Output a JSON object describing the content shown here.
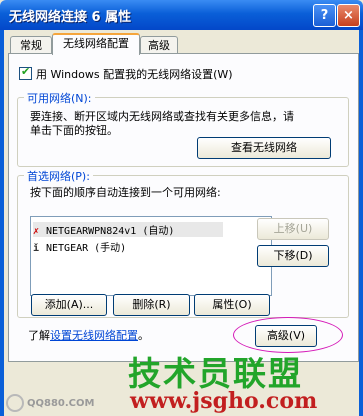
{
  "window": {
    "title": "无线网络连接 6 属性",
    "help_glyph": "?",
    "close_glyph": "×"
  },
  "tabs": [
    {
      "label": "常规"
    },
    {
      "label": "无线网络配置"
    },
    {
      "label": "高级"
    }
  ],
  "use_windows": {
    "label": "用 Windows 配置我的无线网络设置(W)",
    "checked": true,
    "check_glyph": "✔"
  },
  "available": {
    "legend": "可用网络(N):",
    "desc_line1": "要连接、断开区域内无线网络或查找有关更多信息，请",
    "desc_line2": "单击下面的按钮。",
    "view_button": "查看无线网络"
  },
  "preferred": {
    "legend": "首选网络(P):",
    "desc": "按下面的顺序自动连接到一个可用网络:",
    "networks": [
      {
        "icon": "wireless-antenna-x-icon",
        "text": "NETGEARWPN824v1 (自动)",
        "selected": true
      },
      {
        "icon": "wireless-antenna-icon",
        "text": "NETGEAR (手动)",
        "selected": false
      }
    ],
    "move_up": "上移(U)",
    "move_down": "下移(D)",
    "add": "添加(A)...",
    "delete": "删除(R)",
    "properties": "属性(O)"
  },
  "footer": {
    "learn_prefix": "了解",
    "learn_link": "设置无线网络配置",
    "learn_suffix": "。",
    "advanced": "高级(V)"
  },
  "watermark": {
    "big": "技术员联盟",
    "url": "www.jsgho.com",
    "left": "QQ880.COM"
  },
  "colors": {
    "accent_green": "#22a52a",
    "url_red": "#c21f1f",
    "highlight_oval": "#d51ab8"
  }
}
